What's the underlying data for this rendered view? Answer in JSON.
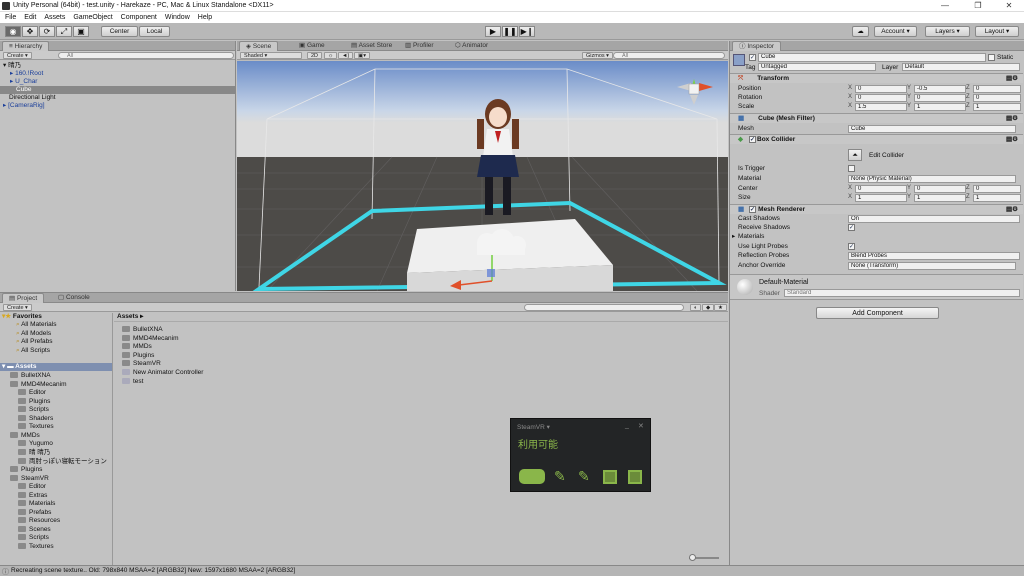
{
  "window": {
    "title": "Unity Personal (64bit) - test.unity - Harekaze - PC, Mac & Linux Standalone <DX11>"
  },
  "menu": [
    "File",
    "Edit",
    "Assets",
    "GameObject",
    "Component",
    "Window",
    "Help"
  ],
  "toolbar": {
    "center": "Center",
    "local": "Local",
    "account": "Account",
    "layers": "Layers",
    "layout": "Layout"
  },
  "hierarchy": {
    "tab": "Hierarchy",
    "create": "Create",
    "search_placeholder": "All",
    "items": [
      "晴乃",
      "160.!Root",
      "U_Char",
      "Cube",
      "Directional Light",
      "[CameraRig]"
    ]
  },
  "scene": {
    "tabs": [
      "Scene",
      "Game",
      "Asset Store",
      "Profiler",
      "Animator"
    ],
    "shaded": "Shaded",
    "mode2d": "2D",
    "gizmos": "Gizmos",
    "search_placeholder": "All"
  },
  "inspector": {
    "tab": "Inspector",
    "object_name": "Cube",
    "static": "Static",
    "tag_label": "Tag",
    "tag": "Untagged",
    "layer_label": "Layer",
    "layer": "Default",
    "transform": {
      "title": "Transform",
      "position_label": "Position",
      "position": [
        "0",
        "-0.5",
        "0"
      ],
      "rotation_label": "Rotation",
      "rotation": [
        "0",
        "0",
        "0"
      ],
      "scale_label": "Scale",
      "scale": [
        "1.5",
        "1",
        "1"
      ]
    },
    "mesh_filter": {
      "title": "Cube (Mesh Filter)",
      "mesh_label": "Mesh",
      "mesh": "Cube"
    },
    "box_collider": {
      "title": "Box Collider",
      "edit": "Edit Collider",
      "is_trigger": "Is Trigger",
      "material_label": "Material",
      "material": "None (Physic Material)",
      "center_label": "Center",
      "center": [
        "0",
        "0",
        "0"
      ],
      "size_label": "Size",
      "size": [
        "1",
        "1",
        "1"
      ]
    },
    "mesh_renderer": {
      "title": "Mesh Renderer",
      "cast_shadows_label": "Cast Shadows",
      "cast_shadows": "On",
      "receive_shadows": "Receive Shadows",
      "materials": "Materials",
      "use_light_probes": "Use Light Probes",
      "reflection_label": "Reflection Probes",
      "reflection": "Blend Probes",
      "anchor_label": "Anchor Override",
      "anchor": "None (Transform)"
    },
    "material": {
      "name": "Default-Material",
      "shader_label": "Shader",
      "shader": "Standard"
    },
    "add_component": "Add Component",
    "axes": [
      "X",
      "Y",
      "Z"
    ]
  },
  "project": {
    "tabs": [
      "Project",
      "Console"
    ],
    "create": "Create",
    "favorites_title": "Favorites",
    "favorites": [
      "All Materials",
      "All Models",
      "All Prefabs",
      "All Scripts"
    ],
    "assets_title": "Assets",
    "tree": [
      {
        "label": "BulletXNA",
        "indent": 1
      },
      {
        "label": "MMD4Mecanim",
        "indent": 1
      },
      {
        "label": "Editor",
        "indent": 2
      },
      {
        "label": "Plugins",
        "indent": 2
      },
      {
        "label": "Scripts",
        "indent": 2
      },
      {
        "label": "Shaders",
        "indent": 2
      },
      {
        "label": "Textures",
        "indent": 2
      },
      {
        "label": "MMDs",
        "indent": 1
      },
      {
        "label": "Yugumo",
        "indent": 2
      },
      {
        "label": "晴 晴乃",
        "indent": 2
      },
      {
        "label": "両肘っぽい寝転モーション",
        "indent": 2
      },
      {
        "label": "Plugins",
        "indent": 1
      },
      {
        "label": "SteamVR",
        "indent": 1
      },
      {
        "label": "Editor",
        "indent": 2
      },
      {
        "label": "Extras",
        "indent": 2
      },
      {
        "label": "Materials",
        "indent": 2
      },
      {
        "label": "Prefabs",
        "indent": 2
      },
      {
        "label": "Resources",
        "indent": 2
      },
      {
        "label": "Scenes",
        "indent": 2
      },
      {
        "label": "Scripts",
        "indent": 2
      },
      {
        "label": "Textures",
        "indent": 2
      }
    ],
    "breadcrumb": "Assets ▸",
    "assets": [
      "BulletXNA",
      "MMD4Mecanim",
      "MMDs",
      "Plugins",
      "SteamVR",
      "New Animator Controller",
      "test"
    ]
  },
  "steamvr": {
    "title": "SteamVR ▾",
    "status": "利用可能",
    "status_color": "#8ab64a"
  },
  "statusbar": {
    "text": "Recreating scene texture.. Old: 798x840 MSAA=2 [ARGB32] New: 1597x1680 MSAA=2 [ARGB32]"
  },
  "colors": {
    "accent_cyan": "#3fd6e6",
    "steam_green": "#8ab64a"
  }
}
